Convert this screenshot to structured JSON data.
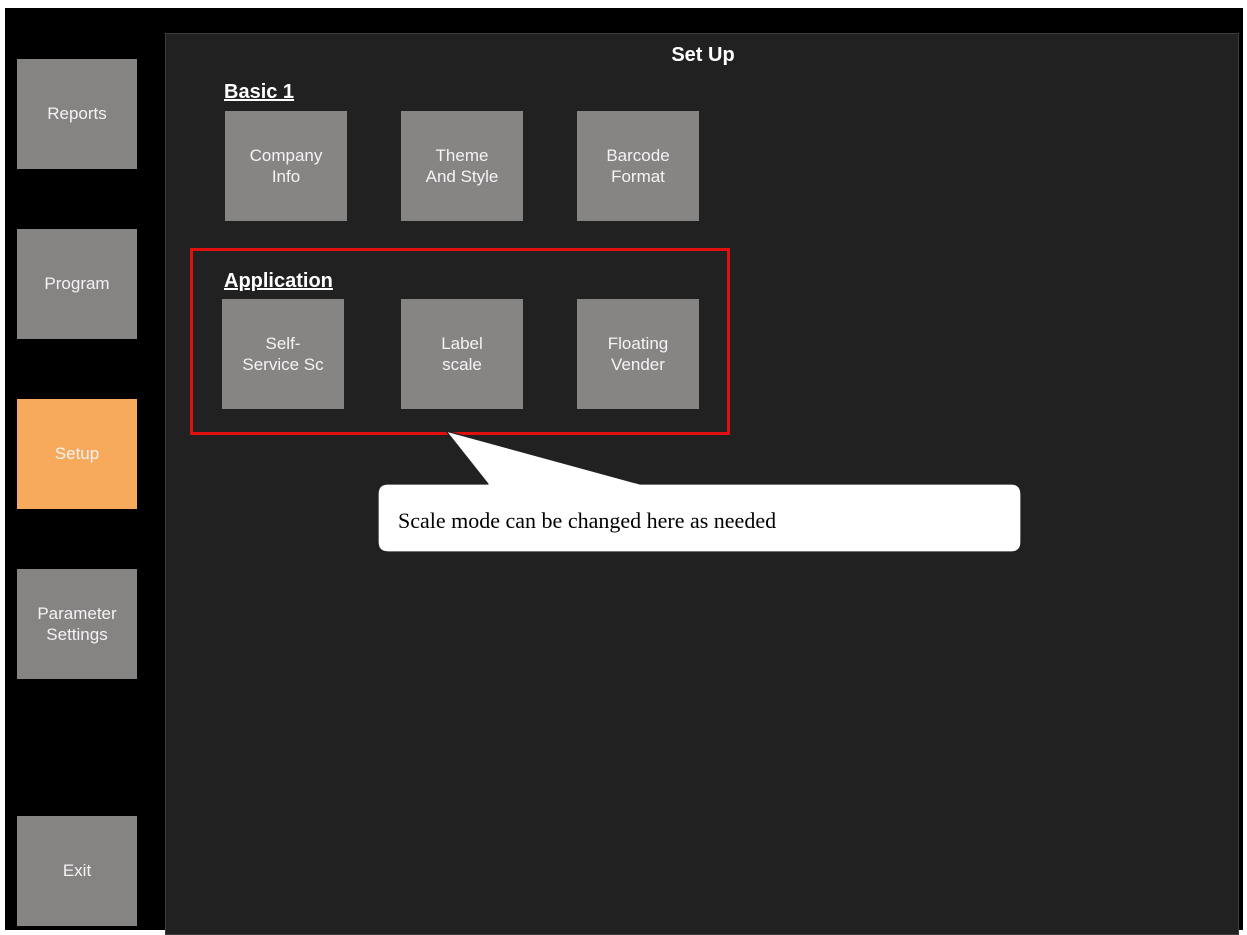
{
  "sidebar": {
    "items": [
      {
        "label": "Reports",
        "active": false
      },
      {
        "label": "Program",
        "active": false
      },
      {
        "label": "Setup",
        "active": true
      },
      {
        "label": "Parameter\nSettings",
        "active": false
      },
      {
        "label": "Exit",
        "active": false
      }
    ]
  },
  "main": {
    "title": "Set Up",
    "sections": [
      {
        "label": "Basic 1",
        "tiles": [
          "Company\nInfo",
          "Theme\nAnd Style",
          "Barcode\nFormat"
        ]
      },
      {
        "label": "Application",
        "tiles": [
          "Self-\nService Sc",
          "Label\nscale",
          "Floating\nVender"
        ]
      }
    ]
  },
  "annotation": {
    "callout_text": "Scale mode can be changed here as needed",
    "highlight_color": "#e01010"
  },
  "colors": {
    "button_gray": "#868383",
    "active_orange": "#f7a95c",
    "panel_bg": "#212121"
  }
}
